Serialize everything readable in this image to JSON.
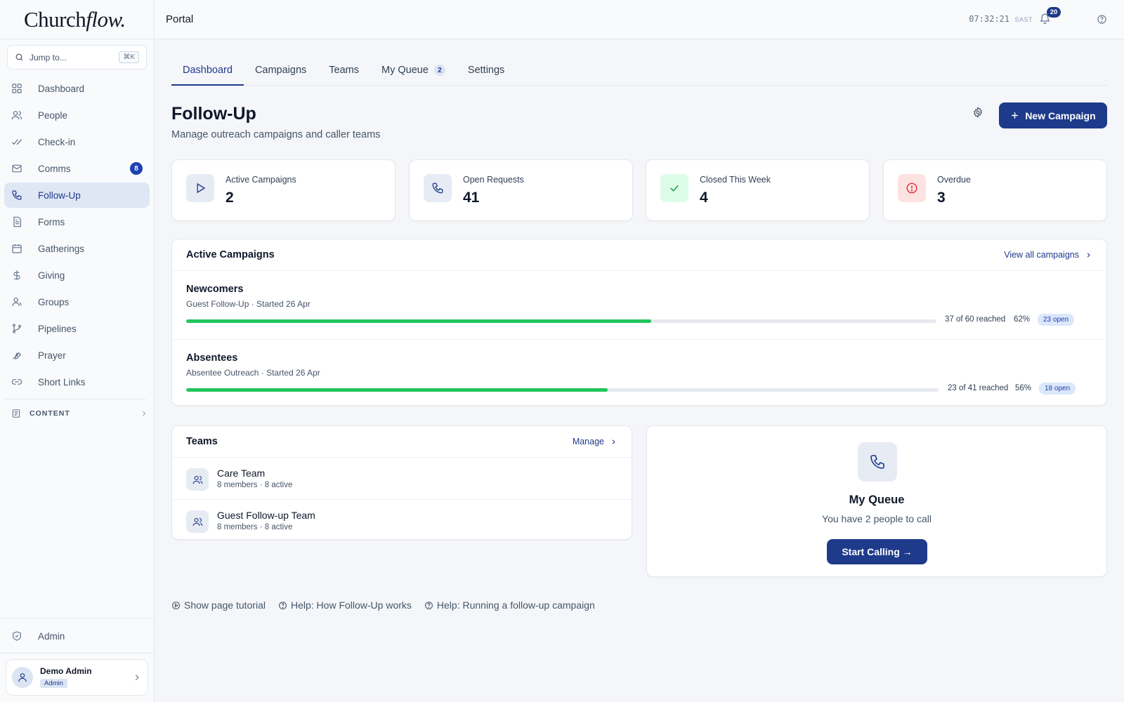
{
  "brand": {
    "part1": "Church",
    "part2": "flow."
  },
  "search": {
    "placeholder": "Jump to...",
    "shortcut": "⌘K"
  },
  "sidebar": {
    "items": [
      {
        "label": "Dashboard",
        "icon": "grid-icon"
      },
      {
        "label": "People",
        "icon": "users-icon"
      },
      {
        "label": "Check-in",
        "icon": "double-check-icon"
      },
      {
        "label": "Comms",
        "icon": "mail-icon",
        "badge": "8"
      },
      {
        "label": "Follow-Up",
        "icon": "phone-icon",
        "active": true
      },
      {
        "label": "Forms",
        "icon": "document-icon"
      },
      {
        "label": "Gatherings",
        "icon": "calendar-icon"
      },
      {
        "label": "Giving",
        "icon": "dollar-icon"
      },
      {
        "label": "Groups",
        "icon": "group-icon"
      },
      {
        "label": "Pipelines",
        "icon": "git-branch-icon"
      },
      {
        "label": "Prayer",
        "icon": "praying-hands-icon"
      },
      {
        "label": "Short Links",
        "icon": "link-icon"
      }
    ],
    "content_section": "CONTENT",
    "admin_label": "Admin",
    "user": {
      "name": "Demo Admin",
      "role": "Admin"
    }
  },
  "topbar": {
    "title": "Portal",
    "clock": "07:32:21",
    "timezone": "SAST",
    "notifications": "20"
  },
  "tabs": [
    {
      "label": "Dashboard",
      "active": true
    },
    {
      "label": "Campaigns"
    },
    {
      "label": "Teams"
    },
    {
      "label": "My Queue",
      "count": "2"
    },
    {
      "label": "Settings"
    }
  ],
  "page": {
    "title": "Follow-Up",
    "subtitle": "Manage outreach campaigns and caller teams",
    "new_button": "New Campaign"
  },
  "stats": [
    {
      "label": "Active Campaigns",
      "value": "2",
      "icon": "play-icon",
      "color": "#1e3a8a",
      "bg": "#e6ebf4"
    },
    {
      "label": "Open Requests",
      "value": "41",
      "icon": "phone-icon",
      "color": "#1e3a8a",
      "bg": "#e6ebf4"
    },
    {
      "label": "Closed This Week",
      "value": "4",
      "icon": "check-icon",
      "color": "#16a34a",
      "bg": "#dcfce7"
    },
    {
      "label": "Overdue",
      "value": "3",
      "icon": "alert-circle-icon",
      "color": "#dc2626",
      "bg": "#fde2e2"
    }
  ],
  "campaigns": {
    "title": "Active Campaigns",
    "link": "View all campaigns",
    "rows": [
      {
        "name": "Newcomers",
        "meta": "Guest Follow-Up · Started 26 Apr",
        "reached": "37 of 60 reached",
        "pct": "62%",
        "progress": 0.62,
        "open": "23 open"
      },
      {
        "name": "Absentees",
        "meta": "Absentee Outreach · Started 26 Apr",
        "reached": "23 of 41 reached",
        "pct": "56%",
        "progress": 0.56,
        "open": "18 open"
      }
    ]
  },
  "teams": {
    "title": "Teams",
    "link": "Manage",
    "rows": [
      {
        "name": "Care Team",
        "meta": "8 members · 8 active"
      },
      {
        "name": "Guest Follow-up Team",
        "meta": "8 members · 8 active"
      }
    ]
  },
  "queue": {
    "title": "My Queue",
    "subtitle": "You have 2 people to call",
    "button": "Start Calling →"
  },
  "help_links": [
    {
      "label": "Show page tutorial",
      "icon": "play-circle-icon"
    },
    {
      "label": "Help: How Follow-Up works",
      "icon": "help-circle-icon"
    },
    {
      "label": "Help: Running a follow-up campaign",
      "icon": "help-circle-icon"
    }
  ]
}
